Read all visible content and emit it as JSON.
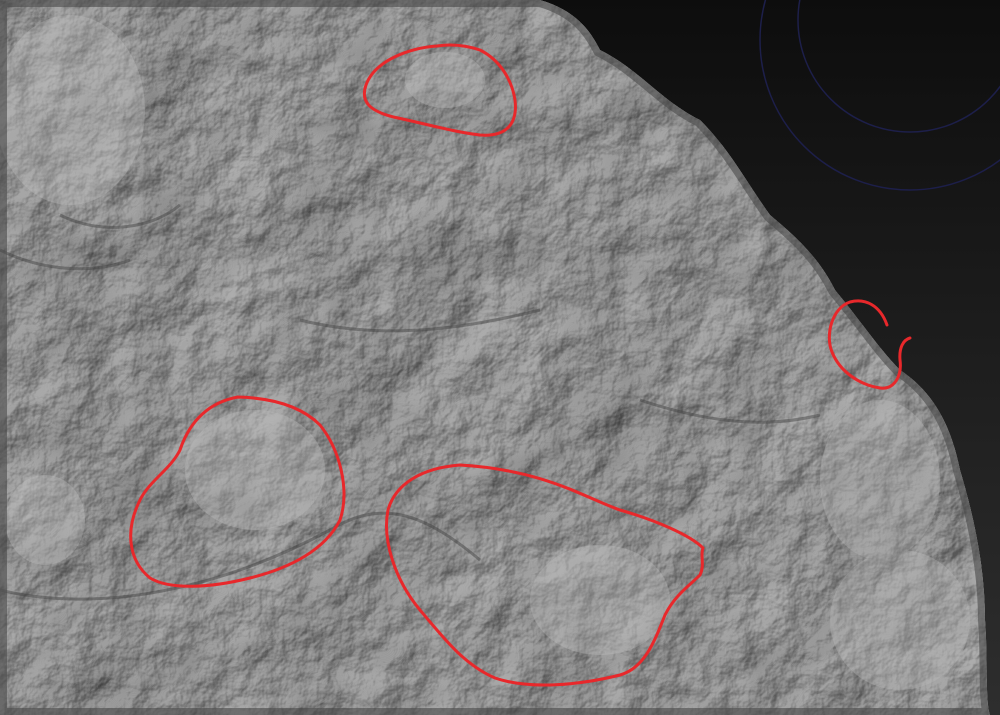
{
  "scene": {
    "background_colors": [
      "#0d0d0d",
      "#2e2e2e"
    ],
    "surface_color": "#8a8a8a",
    "surface_shadow_color": "#4a4a4a",
    "surface_highlight_color": "#b5b5b5",
    "brush_ring_color": "#1d1f4a"
  },
  "annotations": {
    "stroke_color": "#e8282b",
    "marks": [
      {
        "label": "top-center-circle"
      },
      {
        "label": "right-edge-hook"
      },
      {
        "label": "lower-left-circle"
      },
      {
        "label": "lower-center-loop"
      }
    ]
  }
}
